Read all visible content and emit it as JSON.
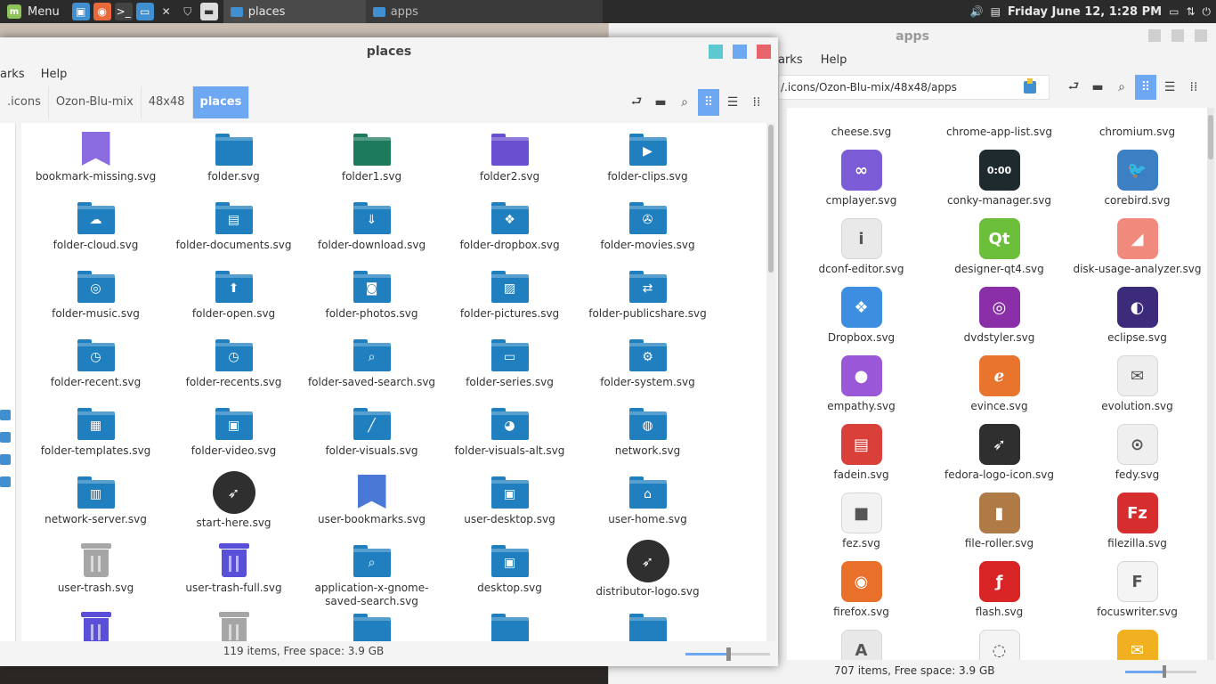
{
  "panel": {
    "menu_label": "Menu",
    "tasks": [
      {
        "label": "places"
      },
      {
        "label": "apps"
      }
    ],
    "clock": "Friday June 12,  1:28 PM"
  },
  "apps_window": {
    "title": "apps",
    "menu": [
      "arks",
      "Help"
    ],
    "path": "/.icons/Ozon-Blu-mix/48x48/apps",
    "status": "707 items, Free space: 3.9 GB",
    "zoom_fraction": 0.55,
    "items": [
      {
        "label": "cheese.svg",
        "color": "",
        "glyph": ""
      },
      {
        "label": "chrome-app-list.svg",
        "color": "",
        "glyph": ""
      },
      {
        "label": "chromium.svg",
        "color": "",
        "glyph": ""
      },
      {
        "label": "cmplayer.svg",
        "color": "#7b5bd6",
        "glyph": "∞"
      },
      {
        "label": "conky-manager.svg",
        "color": "#1f2a2f",
        "glyph": "0:00"
      },
      {
        "label": "corebird.svg",
        "color": "#3c7fc2",
        "glyph": "🐦"
      },
      {
        "label": "dconf-editor.svg",
        "color": "#e9e9e9",
        "glyph": "i"
      },
      {
        "label": "designer-qt4.svg",
        "color": "#6cbf3a",
        "glyph": "Qt"
      },
      {
        "label": "disk-usage-analyzer.svg",
        "color": "#f08a7c",
        "glyph": "◢"
      },
      {
        "label": "Dropbox.svg",
        "color": "#3d8de0",
        "glyph": "❖"
      },
      {
        "label": "dvdstyler.svg",
        "color": "#8a2fa8",
        "glyph": "◎"
      },
      {
        "label": "eclipse.svg",
        "color": "#3b2b7a",
        "glyph": "◐"
      },
      {
        "label": "empathy.svg",
        "color": "#9a58d8",
        "glyph": "●"
      },
      {
        "label": "evince.svg",
        "color": "#e8742e",
        "glyph": "ℯ"
      },
      {
        "label": "evolution.svg",
        "color": "#eeeeee",
        "glyph": "✉"
      },
      {
        "label": "fadein.svg",
        "color": "#d9403a",
        "glyph": "▤"
      },
      {
        "label": "fedora-logo-icon.svg",
        "color": "#2f2f2f",
        "glyph": "➶"
      },
      {
        "label": "fedy.svg",
        "color": "#efefef",
        "glyph": "⊙"
      },
      {
        "label": "fez.svg",
        "color": "#f2f2f2",
        "glyph": "■"
      },
      {
        "label": "file-roller.svg",
        "color": "#b07a46",
        "glyph": "▮"
      },
      {
        "label": "filezilla.svg",
        "color": "#d62e2e",
        "glyph": "Fz"
      },
      {
        "label": "firefox.svg",
        "color": "#e8702a",
        "glyph": "◉"
      },
      {
        "label": "flash.svg",
        "color": "#d82424",
        "glyph": "ƒ"
      },
      {
        "label": "focuswriter.svg",
        "color": "#f4f4f4",
        "glyph": "F"
      },
      {
        "label": "",
        "color": "#e8e8e8",
        "glyph": "A"
      },
      {
        "label": "",
        "color": "#f4f4f4",
        "glyph": "◌"
      },
      {
        "label": "",
        "color": "#f0b020",
        "glyph": "✉"
      }
    ]
  },
  "places_window": {
    "title": "places",
    "menu": [
      "arks",
      "Help"
    ],
    "crumbs": [
      ".icons",
      "Ozon-Blu-mix",
      "48x48",
      "places"
    ],
    "status": "119 items, Free space: 3.9 GB",
    "zoom_fraction": 0.5,
    "controls": {
      "close_color": "#e8646b",
      "max_color": "#6fa8f2",
      "min_color": "#5bc9cf"
    },
    "items": [
      {
        "label": "bookmark-missing.svg",
        "kind": "bookmark",
        "color": "#8b6be0",
        "glyph": ""
      },
      {
        "label": "folder.svg",
        "kind": "folder",
        "color": "#1f7fbf",
        "glyph": ""
      },
      {
        "label": "folder1.svg",
        "kind": "folder",
        "color": "#1d7a5c",
        "glyph": ""
      },
      {
        "label": "folder2.svg",
        "kind": "folder",
        "color": "#6a4fd0",
        "glyph": ""
      },
      {
        "label": "folder-clips.svg",
        "kind": "folder",
        "color": "#1f7fbf",
        "glyph": "▶"
      },
      {
        "label": "folder-cloud.svg",
        "kind": "folder",
        "color": "#1f7fbf",
        "glyph": "☁"
      },
      {
        "label": "folder-documents.svg",
        "kind": "folder",
        "color": "#1f7fbf",
        "glyph": "▤"
      },
      {
        "label": "folder-download.svg",
        "kind": "folder",
        "color": "#1f7fbf",
        "glyph": "⇓"
      },
      {
        "label": "folder-dropbox.svg",
        "kind": "folder",
        "color": "#1f7fbf",
        "glyph": "❖"
      },
      {
        "label": "folder-movies.svg",
        "kind": "folder",
        "color": "#1f7fbf",
        "glyph": "✇"
      },
      {
        "label": "folder-music.svg",
        "kind": "folder",
        "color": "#1f7fbf",
        "glyph": "◎"
      },
      {
        "label": "folder-open.svg",
        "kind": "folder",
        "color": "#1f7fbf",
        "glyph": "⬆"
      },
      {
        "label": "folder-photos.svg",
        "kind": "folder",
        "color": "#1f7fbf",
        "glyph": "◙"
      },
      {
        "label": "folder-pictures.svg",
        "kind": "folder",
        "color": "#1f7fbf",
        "glyph": "▨"
      },
      {
        "label": "folder-publicshare.svg",
        "kind": "folder",
        "color": "#1f7fbf",
        "glyph": "⇄"
      },
      {
        "label": "folder-recent.svg",
        "kind": "folder",
        "color": "#1f7fbf",
        "glyph": "◷"
      },
      {
        "label": "folder-recents.svg",
        "kind": "folder",
        "color": "#1f7fbf",
        "glyph": "◷"
      },
      {
        "label": "folder-saved-search.svg",
        "kind": "folder",
        "color": "#1f7fbf",
        "glyph": "⌕"
      },
      {
        "label": "folder-series.svg",
        "kind": "folder",
        "color": "#1f7fbf",
        "glyph": "▭"
      },
      {
        "label": "folder-system.svg",
        "kind": "folder",
        "color": "#1f7fbf",
        "glyph": "⚙"
      },
      {
        "label": "folder-templates.svg",
        "kind": "folder",
        "color": "#1f7fbf",
        "glyph": "▦"
      },
      {
        "label": "folder-video.svg",
        "kind": "folder",
        "color": "#1f7fbf",
        "glyph": "▣"
      },
      {
        "label": "folder-visuals.svg",
        "kind": "folder",
        "color": "#1f7fbf",
        "glyph": "╱"
      },
      {
        "label": "folder-visuals-alt.svg",
        "kind": "folder",
        "color": "#1f7fbf",
        "glyph": "◕"
      },
      {
        "label": "network.svg",
        "kind": "folder",
        "color": "#1f7fbf",
        "glyph": "◍"
      },
      {
        "label": "network-server.svg",
        "kind": "folder",
        "color": "#1f7fbf",
        "glyph": "▥"
      },
      {
        "label": "start-here.svg",
        "kind": "round",
        "color": "#2f2f2f",
        "glyph": "➶"
      },
      {
        "label": "user-bookmarks.svg",
        "kind": "bookmark",
        "color": "#4a78d6",
        "glyph": ""
      },
      {
        "label": "user-desktop.svg",
        "kind": "folder",
        "color": "#1f7fbf",
        "glyph": "▣"
      },
      {
        "label": "user-home.svg",
        "kind": "folder",
        "color": "#1f7fbf",
        "glyph": "⌂"
      },
      {
        "label": "user-trash.svg",
        "kind": "trash",
        "color": "#a6a6a6",
        "glyph": ""
      },
      {
        "label": "user-trash-full.svg",
        "kind": "trash",
        "color": "#5a4fd8",
        "glyph": ""
      },
      {
        "label": "application-x-gnome-saved-search.svg",
        "kind": "folder",
        "color": "#1f7fbf",
        "glyph": "⌕"
      },
      {
        "label": "desktop.svg",
        "kind": "folder",
        "color": "#1f7fbf",
        "glyph": "▣"
      },
      {
        "label": "distributor-logo.svg",
        "kind": "round",
        "color": "#2f2f2f",
        "glyph": "➶"
      },
      {
        "label": "",
        "kind": "trash",
        "color": "#5a4fd8",
        "glyph": ""
      },
      {
        "label": "",
        "kind": "trash",
        "color": "#a6a6a6",
        "glyph": ""
      },
      {
        "label": "",
        "kind": "folder",
        "color": "#1f7fbf",
        "glyph": ""
      },
      {
        "label": "",
        "kind": "folder",
        "color": "#1f7fbf",
        "glyph": ""
      },
      {
        "label": "",
        "kind": "folder",
        "color": "#1f7fbf",
        "glyph": ""
      }
    ]
  }
}
